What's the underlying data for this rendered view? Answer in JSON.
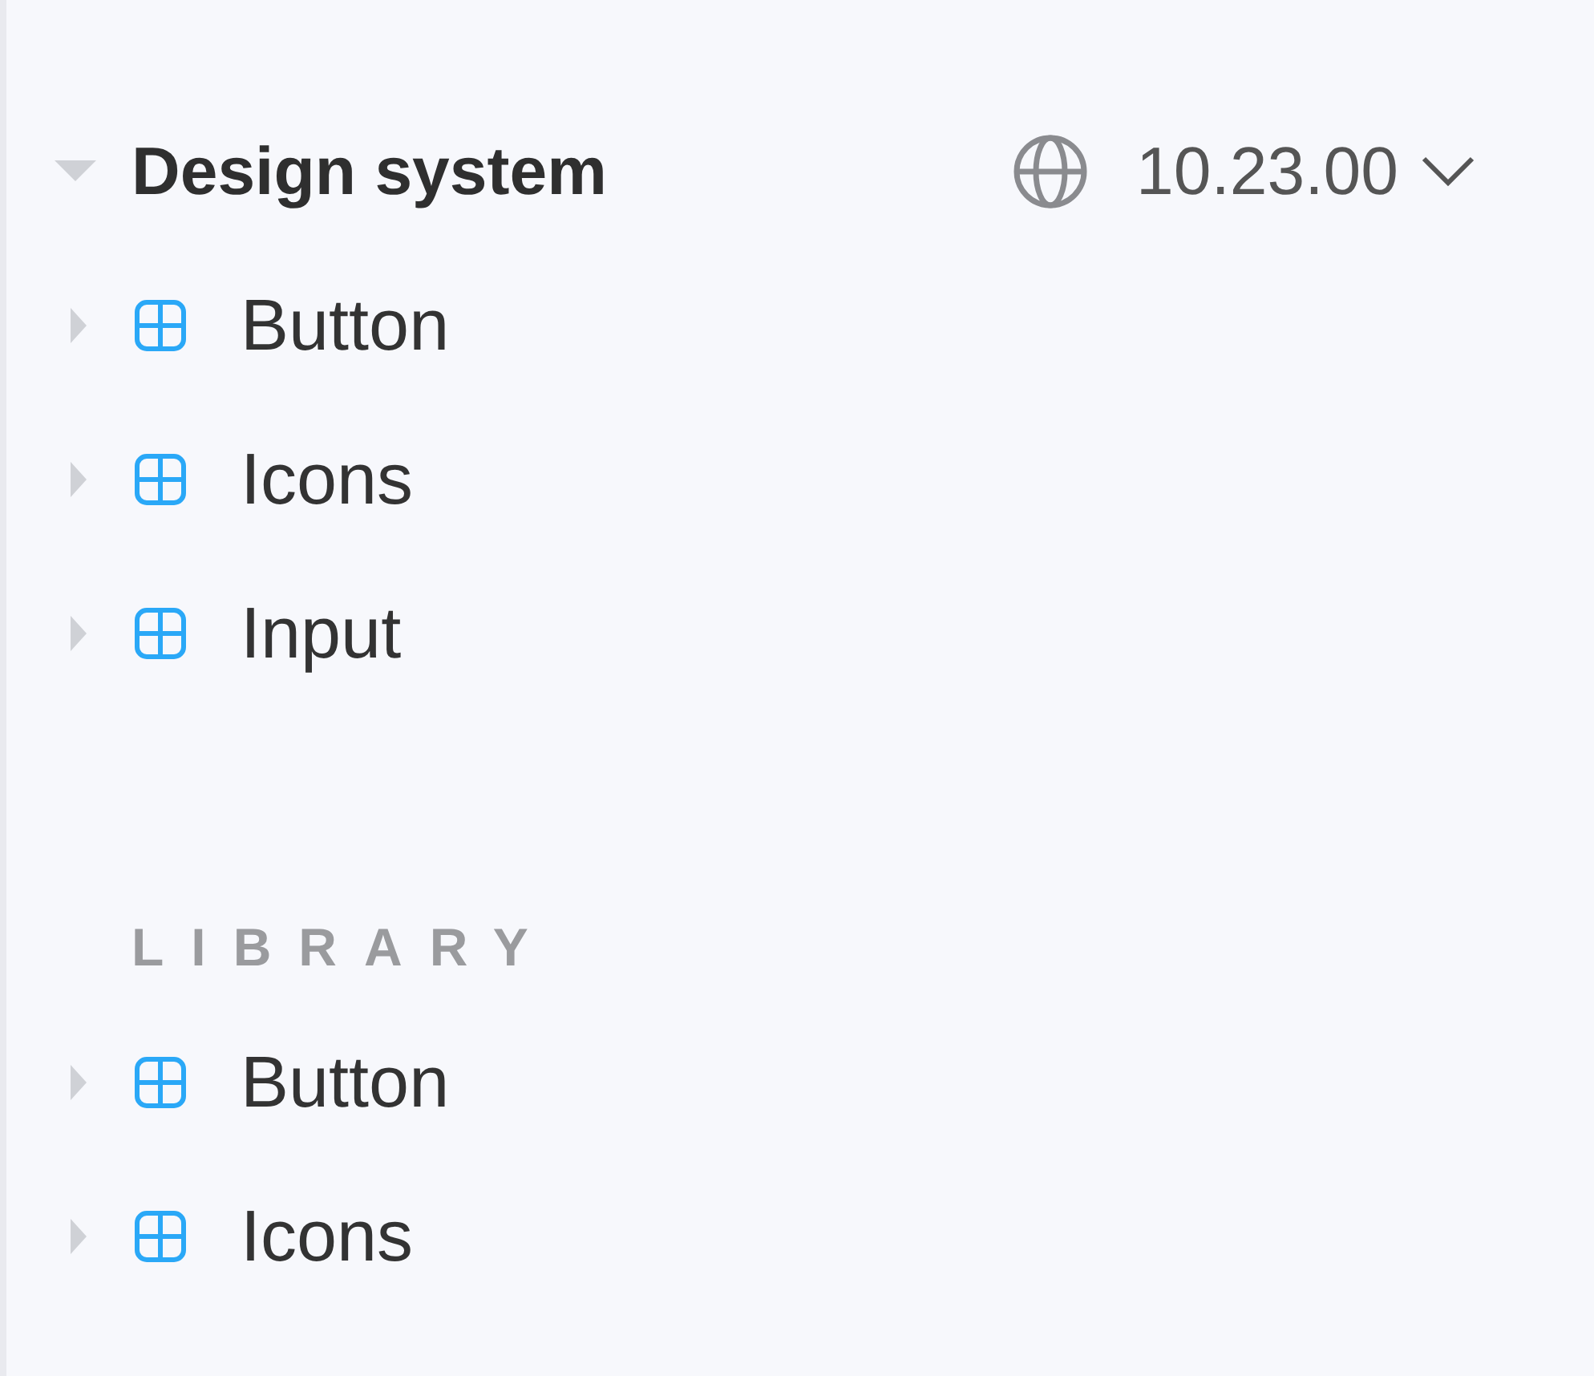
{
  "tree": {
    "label": "Design system",
    "expanded": true,
    "version": "10.23.00",
    "children": [
      {
        "label": "Button",
        "expanded": false
      },
      {
        "label": "Icons",
        "expanded": false
      },
      {
        "label": "Input",
        "expanded": false
      }
    ]
  },
  "library": {
    "heading": "LIBRARY",
    "items": [
      {
        "label": "Button",
        "expanded": false
      },
      {
        "label": "Icons",
        "expanded": false
      }
    ]
  }
}
